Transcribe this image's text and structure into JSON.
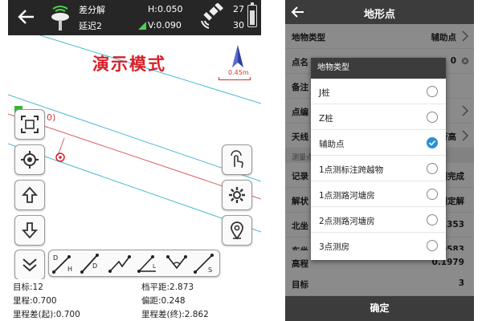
{
  "left": {
    "status": {
      "mode": "差分解",
      "latency": "延迟2",
      "h": "H:0.050",
      "v": "V:0.090",
      "sats_used": "27",
      "sats_visible": "30"
    },
    "demo_text": "演示模式",
    "scale_text": "0.45m",
    "point_label": "0)",
    "info": {
      "target": "目标:12",
      "offset_horiz": "档平距:2.873",
      "mileage": "里程:0.700",
      "offset": "偏距:0.248",
      "mileage_diff_start": "里程差(起):0.700",
      "mileage_diff_end": "里程差(终):2.862"
    },
    "accent": "#d8202a"
  },
  "right": {
    "title": "地形点",
    "rows": [
      {
        "label": "地物类型",
        "value": "辅助点"
      },
      {
        "label": "点名",
        "value": "0"
      },
      {
        "label": "备注",
        "value": ""
      },
      {
        "label": "点编",
        "value": ""
      },
      {
        "label": "天线",
        "value": "行高"
      }
    ],
    "section_label": "测量点",
    "rows2": [
      {
        "label": "记录",
        "value": "测完成"
      },
      {
        "label": "解状",
        "value": "固定解"
      },
      {
        "label": "北坐",
        "value": "3353"
      },
      {
        "label": "东坐",
        "value": "0583"
      },
      {
        "label": "高程",
        "value": "0.1979"
      },
      {
        "label": "目标",
        "value": "3"
      }
    ],
    "confirm": "确定",
    "dialog": {
      "title": "地物类型",
      "options": [
        "J桩",
        "Z桩",
        "辅助点",
        "1点测标注跨越物",
        "1点测路河塘房",
        "2点测路河塘房",
        "3点测房"
      ],
      "selected": "辅助点"
    },
    "accent": "#2a8fd8"
  }
}
